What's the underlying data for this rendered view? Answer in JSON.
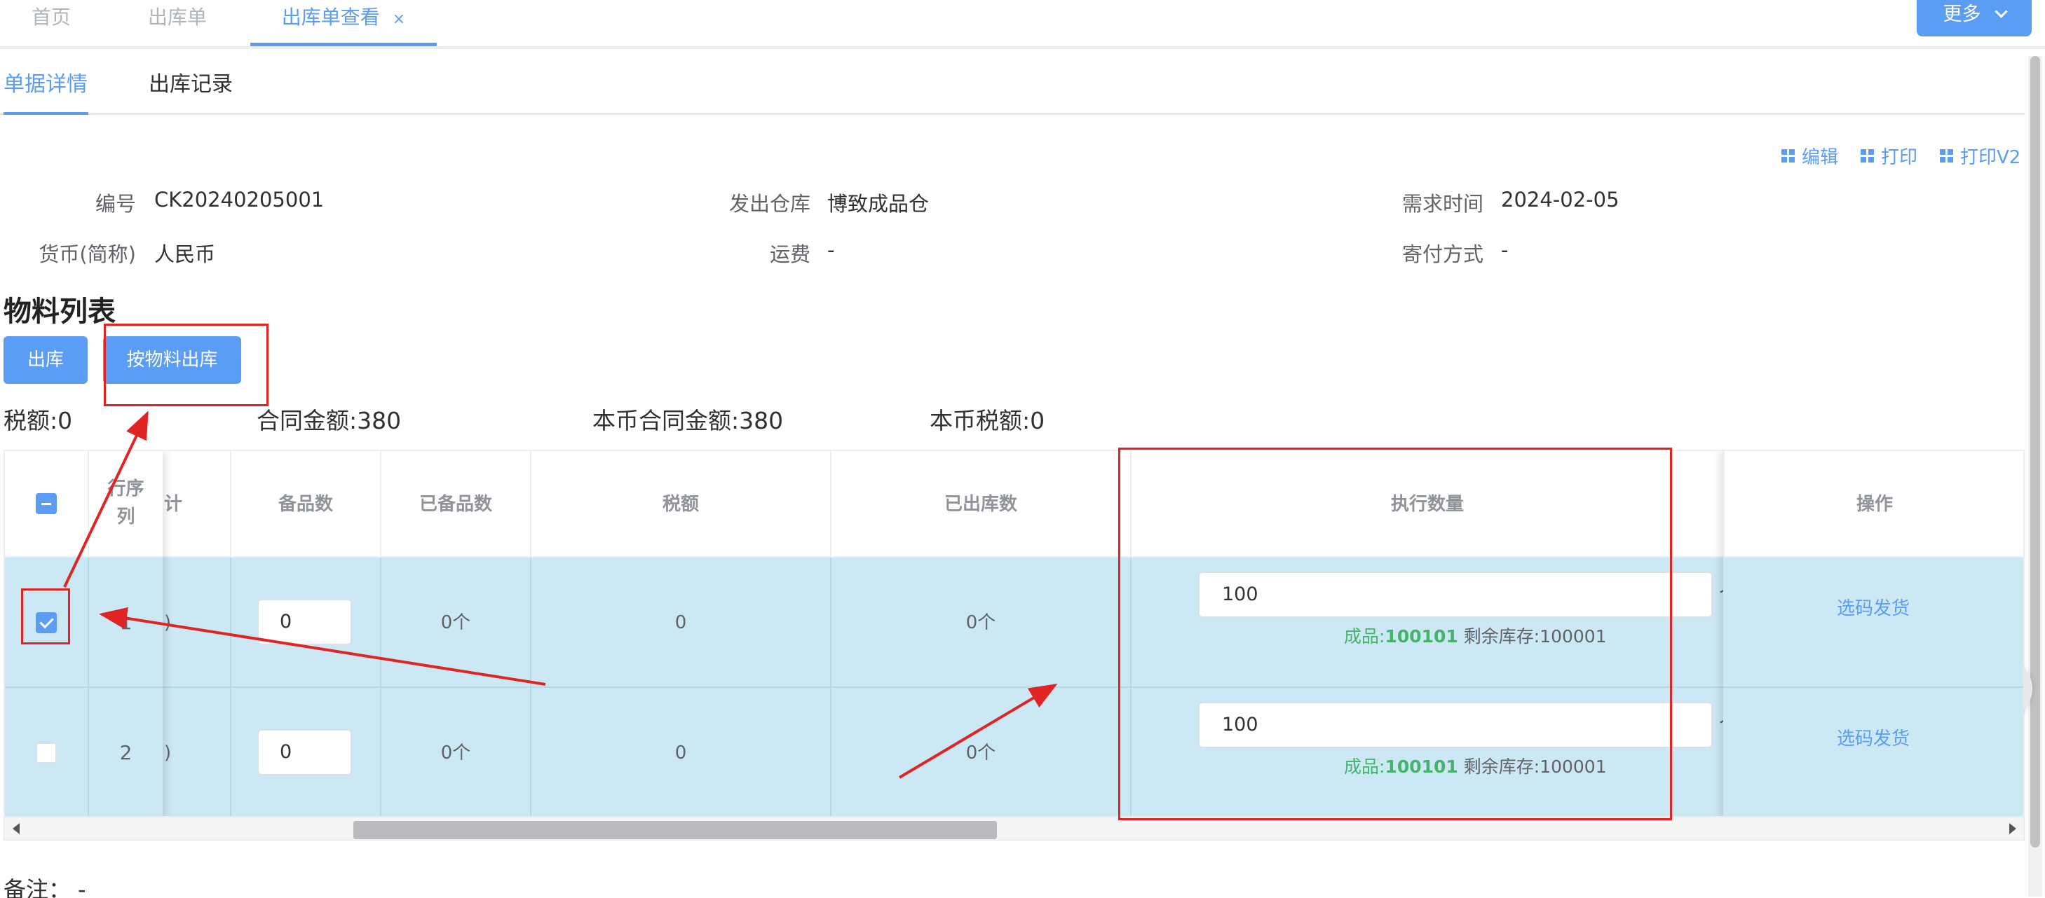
{
  "page_tabs": [
    {
      "label": "首页"
    },
    {
      "label": "出库单"
    },
    {
      "label": "出库单查看",
      "close": "×"
    }
  ],
  "more_button": "更多",
  "sub_tabs": [
    {
      "label": "单据详情"
    },
    {
      "label": "出库记录"
    }
  ],
  "actions": {
    "edit": "编辑",
    "print": "打印",
    "print_v2": "打印V2"
  },
  "info": {
    "code_label": "编号",
    "code": "CK20240205001",
    "warehouse_label": "发出仓库",
    "warehouse": "博致成品仓",
    "demand_time_label": "需求时间",
    "demand_time": "2024-02-05",
    "currency_label": "货币(简称)",
    "currency": "人民币",
    "freight_label": "运费",
    "freight": "-",
    "shipping_label": "寄付方式",
    "shipping": "-"
  },
  "material_title": "物料列表",
  "buttons": {
    "outbound": "出库",
    "outbound_by_material": "按物料出库"
  },
  "summary": {
    "tax": "税额:0",
    "contract_amount": "合同金额:380",
    "local_contract_amount": "本币合同金额:380",
    "local_tax": "本币税额:0"
  },
  "table": {
    "headers": {
      "seq": "行序\n列",
      "partial": "计",
      "spare": "备品数",
      "spared": "已备品数",
      "tax": "税额",
      "shipped": "已出库数",
      "exec_qty": "执行数量",
      "ops": "操作"
    },
    "rows": [
      {
        "checked": true,
        "seq": "1",
        "partial": ")",
        "spare": "0",
        "spared": "0个",
        "tax": "0",
        "shipped": "0个",
        "exec_qty": "100",
        "unit_peek": "个",
        "stock_prefix": "成品:",
        "stock_code": "100101",
        "stock_remain": "剩余库存:100001",
        "op": "选码发货"
      },
      {
        "checked": false,
        "seq": "2",
        "partial": ")",
        "spare": "0",
        "spared": "0个",
        "tax": "0",
        "shipped": "0个",
        "exec_qty": "100",
        "unit_peek": "个",
        "stock_prefix": "成品:",
        "stock_code": "100101",
        "stock_remain": "剩余库存:100001",
        "op": "选码发货"
      }
    ]
  },
  "note": {
    "label": "备注：",
    "value": "-"
  },
  "colors": {
    "accent": "#5b9cf5",
    "row_highlight": "#cce8f5",
    "annotation": "#e02424",
    "stock_green": "#45b36b"
  }
}
